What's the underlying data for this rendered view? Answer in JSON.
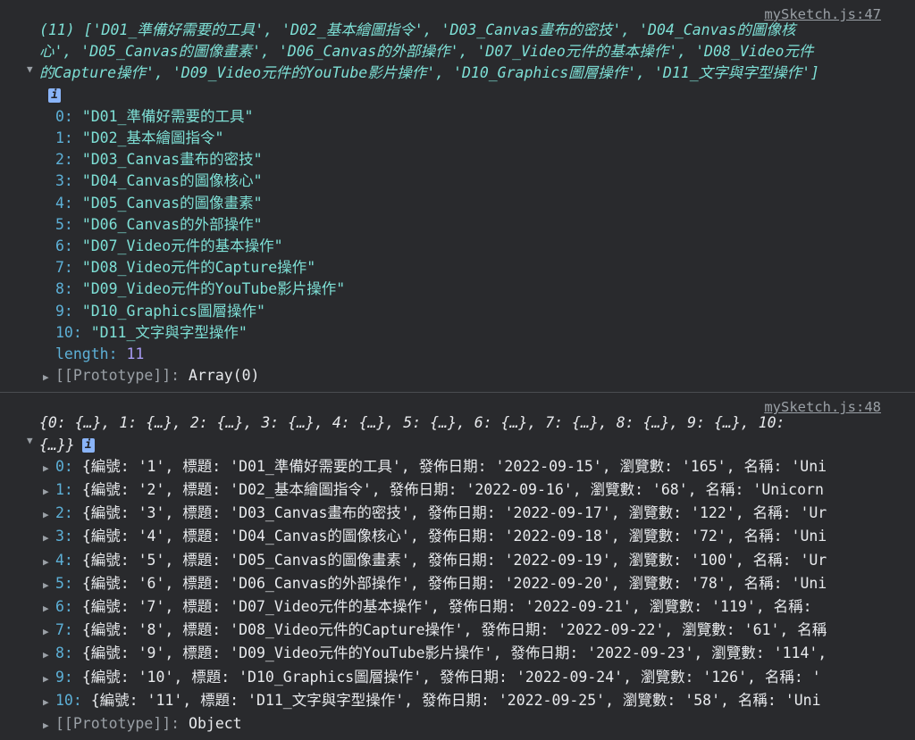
{
  "msg1": {
    "source": "mySketch.js:47",
    "summary_line1": "(11) ['D01_準備好需要的工具', 'D02_基本繪圖指令', 'D03_Canvas畫布的密技', 'D04_Canvas的圖像核",
    "summary_line2": "心', 'D05_Canvas的圖像畫素', 'D06_Canvas的外部操作', 'D07_Video元件的基本操作', 'D08_Video元件",
    "summary_line3": "的Capture操作', 'D09_Video元件的YouTube影片操作', 'D10_Graphics圖層操作', 'D11_文字與字型操作']",
    "items": [
      {
        "idx": "0:",
        "val": "\"D01_準備好需要的工具\""
      },
      {
        "idx": "1:",
        "val": "\"D02_基本繪圖指令\""
      },
      {
        "idx": "2:",
        "val": "\"D03_Canvas畫布的密技\""
      },
      {
        "idx": "3:",
        "val": "\"D04_Canvas的圖像核心\""
      },
      {
        "idx": "4:",
        "val": "\"D05_Canvas的圖像畫素\""
      },
      {
        "idx": "5:",
        "val": "\"D06_Canvas的外部操作\""
      },
      {
        "idx": "6:",
        "val": "\"D07_Video元件的基本操作\""
      },
      {
        "idx": "7:",
        "val": "\"D08_Video元件的Capture操作\""
      },
      {
        "idx": "8:",
        "val": "\"D09_Video元件的YouTube影片操作\""
      },
      {
        "idx": "9:",
        "val": "\"D10_Graphics圖層操作\""
      },
      {
        "idx": "10:",
        "val": "\"D11_文字與字型操作\""
      }
    ],
    "length_key": "length:",
    "length_val": "11",
    "proto_key": "[[Prototype]]:",
    "proto_val": "Array(0)"
  },
  "msg2": {
    "source": "mySketch.js:48",
    "summary_line1": "{0: {…}, 1: {…}, 2: {…}, 3: {…}, 4: {…}, 5: {…}, 6: {…}, 7: {…}, 8: {…}, 9: {…}, 10:",
    "summary_line2": "{…}}",
    "rows": [
      {
        "idx": "0:",
        "text": "{編號: '1', 標題: 'D01_準備好需要的工具', 發佈日期: '2022-09-15', 瀏覽數: '165', 名稱: 'Uni"
      },
      {
        "idx": "1:",
        "text": "{編號: '2', 標題: 'D02_基本繪圖指令', 發佈日期: '2022-09-16', 瀏覽數: '68', 名稱: 'Unicorn"
      },
      {
        "idx": "2:",
        "text": "{編號: '3', 標題: 'D03_Canvas畫布的密技', 發佈日期: '2022-09-17', 瀏覽數: '122', 名稱: 'Ur"
      },
      {
        "idx": "3:",
        "text": "{編號: '4', 標題: 'D04_Canvas的圖像核心', 發佈日期: '2022-09-18', 瀏覽數: '72', 名稱: 'Uni"
      },
      {
        "idx": "4:",
        "text": "{編號: '5', 標題: 'D05_Canvas的圖像畫素', 發佈日期: '2022-09-19', 瀏覽數: '100', 名稱: 'Ur"
      },
      {
        "idx": "5:",
        "text": "{編號: '6', 標題: 'D06_Canvas的外部操作', 發佈日期: '2022-09-20', 瀏覽數: '78', 名稱: 'Uni"
      },
      {
        "idx": "6:",
        "text": "{編號: '7', 標題: 'D07_Video元件的基本操作', 發佈日期: '2022-09-21', 瀏覽數: '119', 名稱:"
      },
      {
        "idx": "7:",
        "text": "{編號: '8', 標題: 'D08_Video元件的Capture操作', 發佈日期: '2022-09-22', 瀏覽數: '61', 名稱"
      },
      {
        "idx": "8:",
        "text": "{編號: '9', 標題: 'D09_Video元件的YouTube影片操作', 發佈日期: '2022-09-23', 瀏覽數: '114',"
      },
      {
        "idx": "9:",
        "text": "{編號: '10', 標題: 'D10_Graphics圖層操作', 發佈日期: '2022-09-24', 瀏覽數: '126', 名稱: '"
      },
      {
        "idx": "10:",
        "text": "{編號: '11', 標題: 'D11_文字與字型操作', 發佈日期: '2022-09-25', 瀏覽數: '58', 名稱: 'Uni"
      }
    ],
    "proto_key": "[[Prototype]]:",
    "proto_val": "Object"
  },
  "colors": {
    "background": "#292a2d",
    "string": "#7ee0d6",
    "number": "#a89bf4",
    "key": "#9aa0a6",
    "index": "#5db0d7",
    "info_badge": "#8ab4f8"
  },
  "icons": {
    "expand": "triangle-down-icon",
    "collapsed": "triangle-right-icon",
    "info": "info-icon"
  }
}
